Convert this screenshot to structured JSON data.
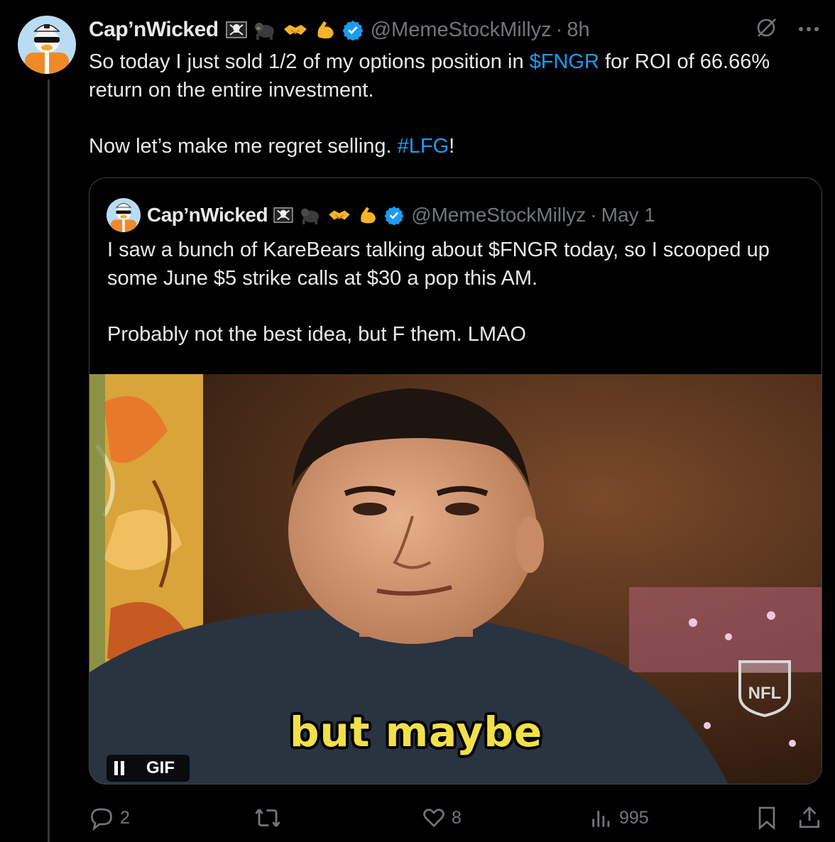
{
  "post": {
    "author_name": "Cap’nWicked",
    "author_emojis": [
      "skull-crossbones-flag",
      "gorilla",
      "handshake",
      "flexed-biceps"
    ],
    "handle": "@MemeStockMillyz",
    "separator": "·",
    "time": "8h",
    "text_line1_before": "So today I just sold 1/2 of my options position in ",
    "text_line1_link": "$FNGR",
    "text_line1_after": " for ROI of 66.66% return on the entire investment.",
    "text_line2_before": "Now let’s make me regret selling. ",
    "text_line2_link": "#LFG",
    "text_line2_after": "!",
    "link_color": "#1d9bf0"
  },
  "quote": {
    "author_name": "Cap’nWicked",
    "handle": "@MemeStockMillyz",
    "separator": "·",
    "time": "May 1",
    "text_p1": "I saw a bunch of KareBears talking about $FNGR today, so I scooped up some June $5 strike calls at $30 a pop this AM.",
    "text_p2": "Probably not the best idea, but F them. LMAO",
    "media": {
      "caption": "but maybe",
      "badge_label": "GIF",
      "watermark": "NFL"
    }
  },
  "actions": {
    "reply_count": "2",
    "repost_count": "",
    "like_count": "8",
    "view_count": "995"
  },
  "icons": {
    "verified": "verified-badge-icon",
    "grok": "grok-icon",
    "more": "more-icon",
    "reply": "reply-icon",
    "repost": "repost-icon",
    "like": "like-icon",
    "views": "views-icon",
    "bookmark": "bookmark-icon",
    "share": "share-icon"
  },
  "colors": {
    "background": "#000000",
    "text": "#e7e9ea",
    "secondary": "#71767b",
    "verified": "#1d9bf0",
    "caption": "#f2e04a"
  }
}
